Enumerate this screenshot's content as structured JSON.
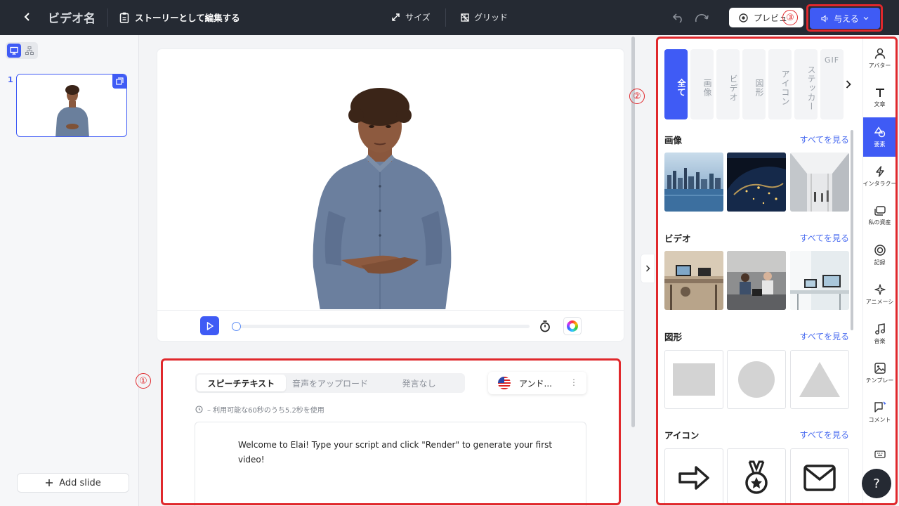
{
  "topbar": {
    "video_name": "ビデオ名",
    "story_label": "ストーリーとして編集する",
    "size_label": "サイズ",
    "grid_label": "グリッド",
    "preview_label": "プレビュ",
    "give_label": "与える"
  },
  "markers": {
    "m1": "①",
    "m2": "②",
    "m3": "③"
  },
  "sidebar": {
    "slide_number": "1",
    "add_slide_label": "Add slide"
  },
  "speech": {
    "tabs": [
      "スピーチテキスト",
      "音声をアップロード",
      "発言なし"
    ],
    "voice_name": "アンド...",
    "voice_more": "⋮",
    "usage": "– 利用可能な60秒のうち5.2秒を使用",
    "script": "Welcome to Elai! Type your script and click \"Render\" to generate your first video!"
  },
  "right_panel": {
    "categories": [
      "全て",
      "画像",
      "ビデオ",
      "図形",
      "アイコン",
      "ステッカー",
      "GIF"
    ],
    "sections": [
      {
        "title": "画像",
        "see_all": "すべてを見る"
      },
      {
        "title": "ビデオ",
        "see_all": "すべてを見る"
      },
      {
        "title": "図形",
        "see_all": "すべてを見る"
      },
      {
        "title": "アイコン",
        "see_all": "すべてを見る"
      }
    ]
  },
  "rail": {
    "items": [
      "アバター",
      "文章",
      "要素",
      "インタラクー",
      "私の資産",
      "記録",
      "アニメーシ",
      "音楽",
      "テンプレー",
      "コメント"
    ],
    "help": "?"
  },
  "colors": {
    "accent": "#3f5bf5",
    "topbar": "#252a33",
    "highlight": "#e0282c"
  }
}
